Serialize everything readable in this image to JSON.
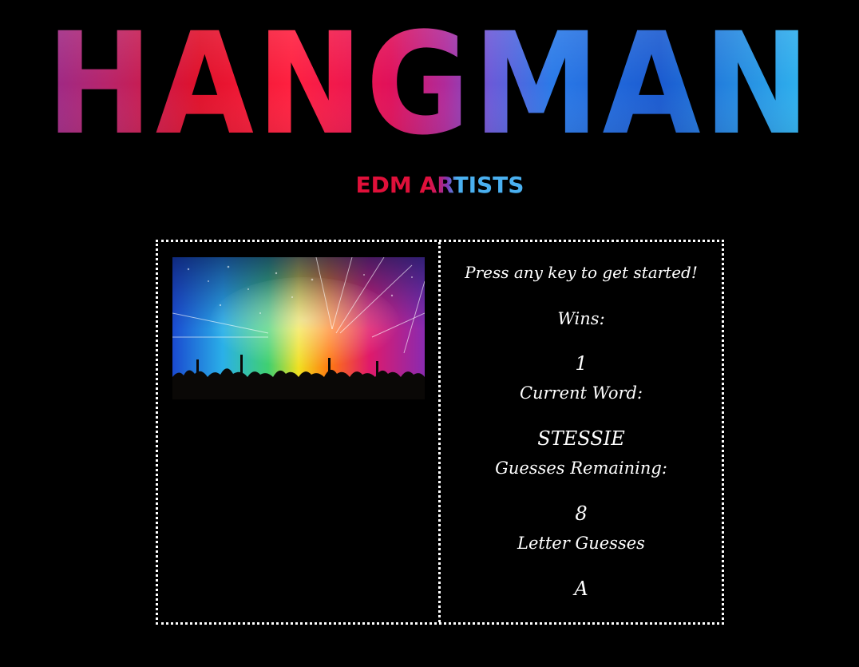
{
  "header": {
    "title": "HANGMAN",
    "subtitle": "EDM ARTISTS"
  },
  "game": {
    "prompt": "Press any key to get started!",
    "wins_label": "Wins:",
    "wins_value": "1",
    "current_word_label": "Current Word:",
    "current_word_value": "STESSIE",
    "guesses_remaining_label": "Guesses Remaining:",
    "guesses_remaining_value": "8",
    "letter_guesses_label": "Letter Guesses",
    "letter_guesses_value": "A"
  },
  "colors": {
    "background": "#000000",
    "text": "#ffffff",
    "title_gradient": [
      "#8a1a6e",
      "#e0102a",
      "#ff1a3a",
      "#c41a8a",
      "#2a6be0",
      "#1a8ae8",
      "#2ab0f0"
    ],
    "subtitle_gradient": [
      "#e0103a",
      "#c81a6a",
      "#6a3ab0",
      "#3a9ae8"
    ]
  }
}
